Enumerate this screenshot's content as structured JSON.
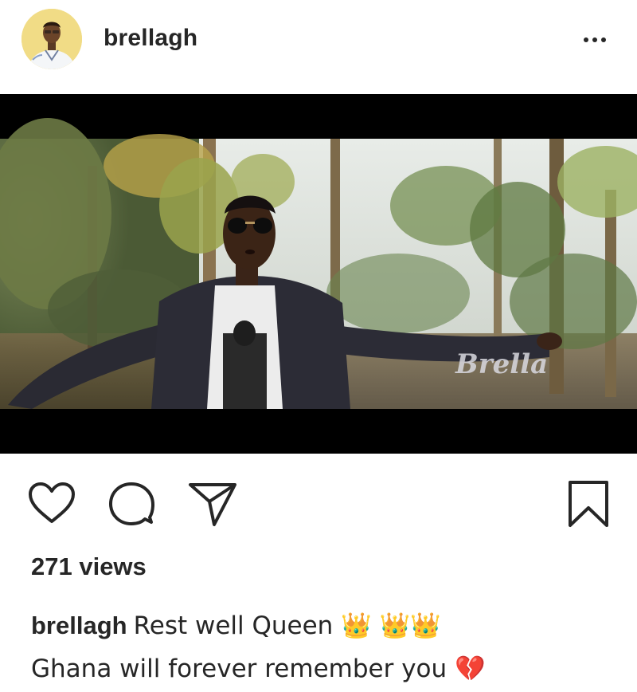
{
  "post": {
    "username": "brellagh",
    "video": {
      "watermark": "Brella"
    },
    "views_text": "271 views",
    "caption": {
      "username": "brellagh",
      "line1": "Rest well Queen 👑 👑👑",
      "line2": "Ghana will forever remember you 💔"
    }
  },
  "icons": {
    "like": "heart-icon",
    "comment": "comment-icon",
    "share": "paper-plane-icon",
    "save": "bookmark-icon",
    "more": "more-dots-icon"
  },
  "colors": {
    "text": "#262626",
    "background": "#ffffff",
    "letterbox": "#000000"
  }
}
